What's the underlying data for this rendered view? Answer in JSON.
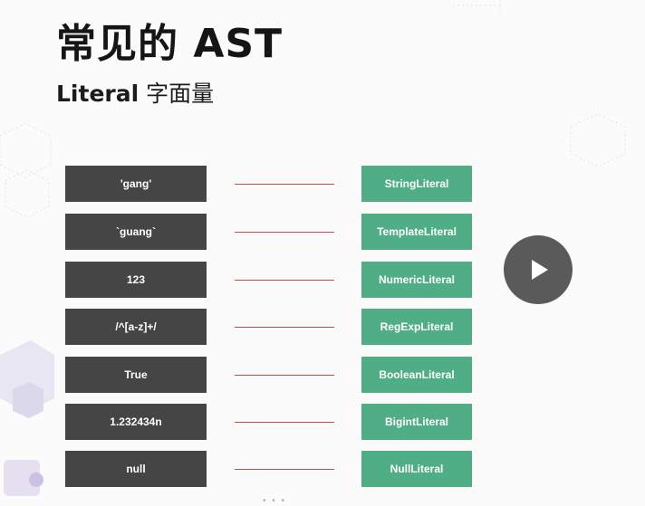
{
  "slide": {
    "title": "常见的 AST",
    "subtitle_literal": "Literal",
    "subtitle_cn": "字面量"
  },
  "mappings": [
    {
      "value": "'gang'",
      "type": "StringLiteral"
    },
    {
      "value": "`guang`",
      "type": "TemplateLiteral"
    },
    {
      "value": "123",
      "type": "NumericLiteral"
    },
    {
      "value": "/^[a-z]+/",
      "type": "RegExpLiteral"
    },
    {
      "value": "True",
      "type": "BooleanLiteral"
    },
    {
      "value": "1.232434n",
      "type": "BigintLiteral"
    },
    {
      "value": "null",
      "type": "NullLiteral"
    }
  ],
  "player": {
    "icon": "play-icon"
  },
  "colors": {
    "value_box": "#454545",
    "type_box": "#4fae85",
    "connector": "#c94a4a",
    "play_button": "#5a5a5a"
  }
}
